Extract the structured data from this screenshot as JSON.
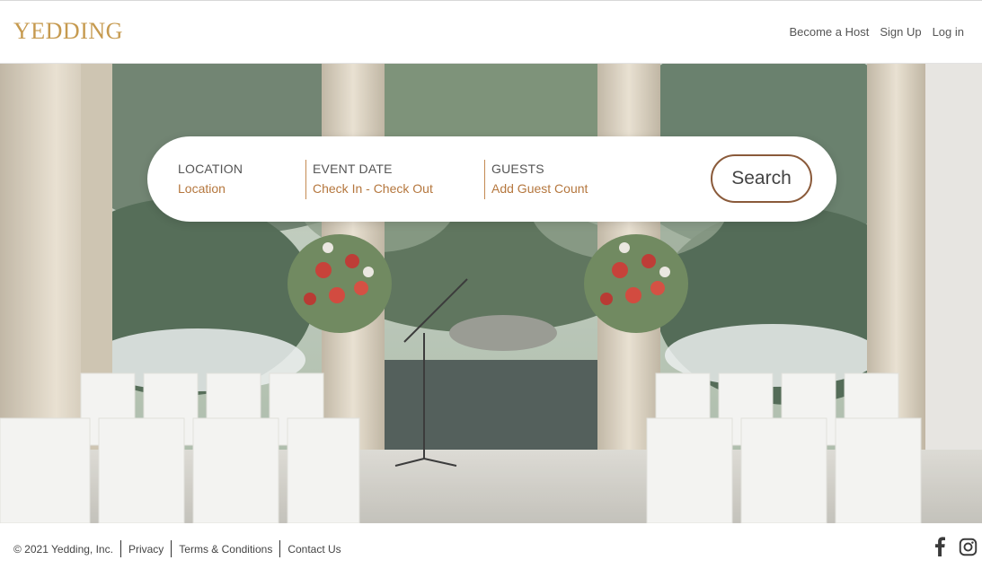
{
  "brand": {
    "logo_text": "YEDDING",
    "accent_color": "#c69a4f"
  },
  "nav": {
    "become_host": "Become a Host",
    "sign_up": "Sign Up",
    "log_in": "Log in"
  },
  "search": {
    "location": {
      "label": "LOCATION",
      "value": "Location"
    },
    "event_date": {
      "label": "EVENT DATE",
      "value": "Check In - Check Out"
    },
    "guests": {
      "label": "GUESTS",
      "value": "Add Guest Count"
    },
    "button_label": "Search"
  },
  "footer": {
    "copyright": "© 2021 Yedding, Inc.",
    "privacy": "Privacy",
    "terms": "Terms & Conditions",
    "contact": "Contact Us",
    "social_icons": [
      "facebook-icon",
      "instagram-icon"
    ]
  }
}
